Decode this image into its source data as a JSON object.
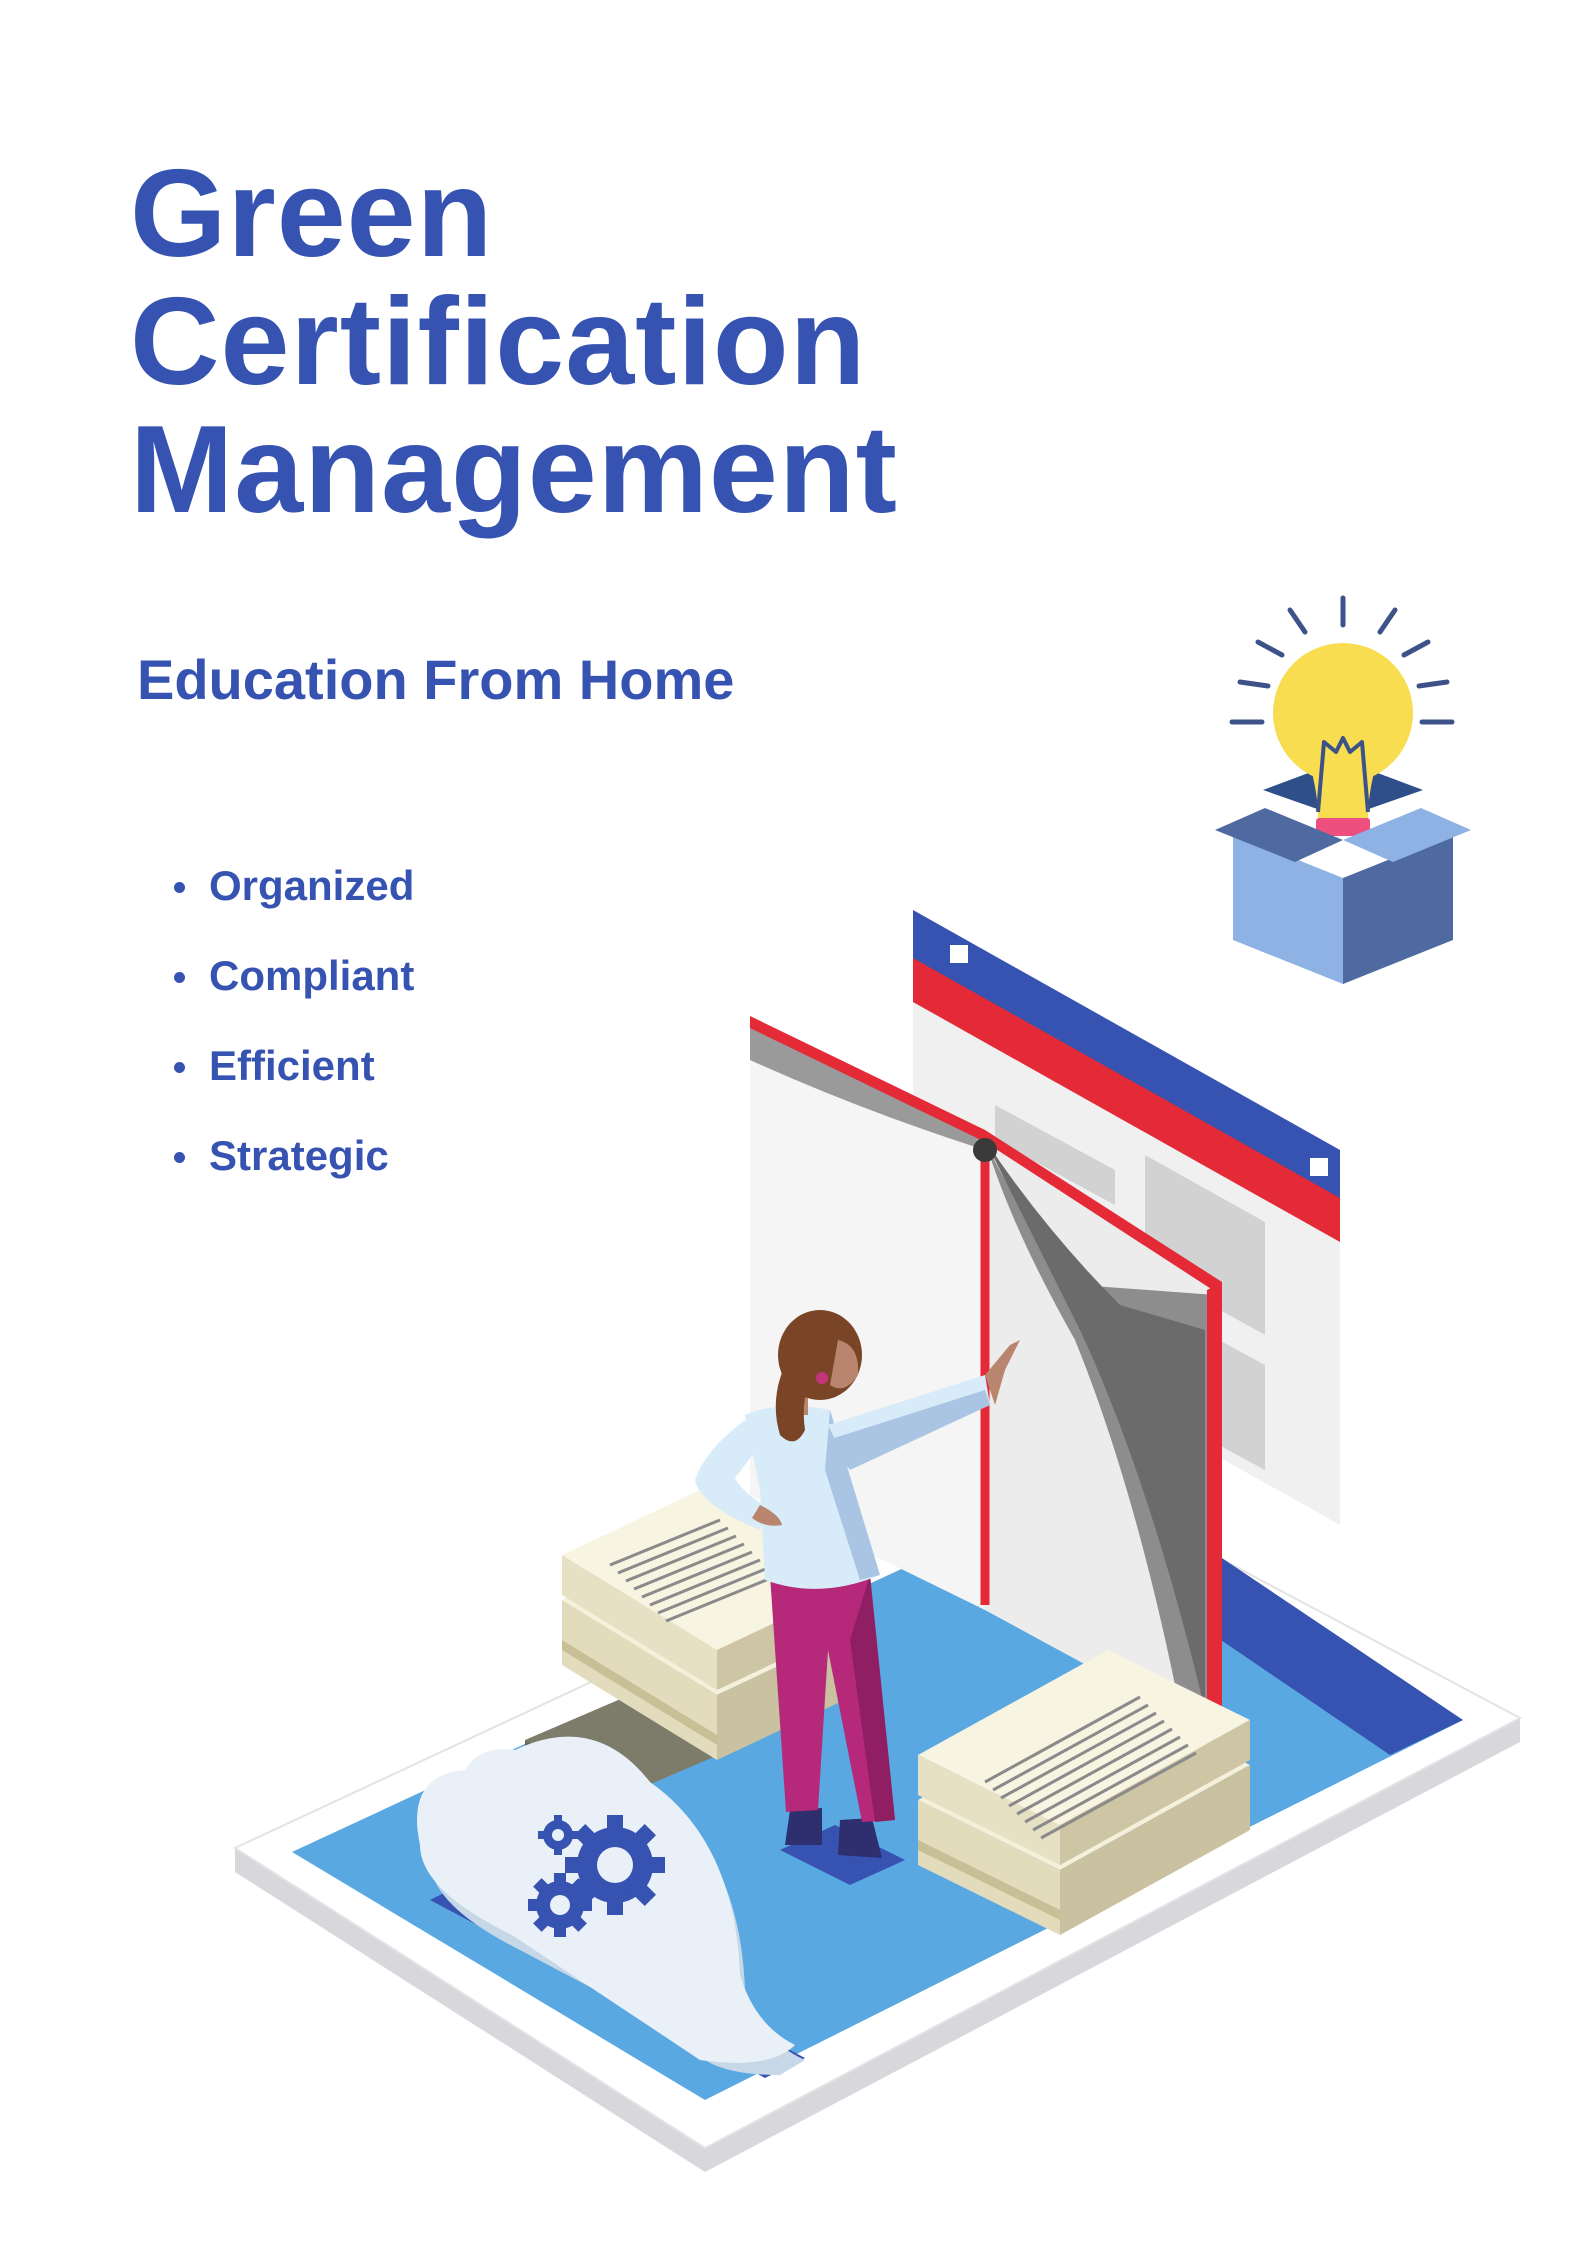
{
  "title_lines": [
    "Green",
    "Certification",
    "Management"
  ],
  "subtitle": "Education From Home",
  "features": [
    "Organized",
    "Compliant",
    "Efficient",
    "Strategic"
  ],
  "colors": {
    "primary_text": "#3653b2",
    "platform_blue": "#5aa8e2",
    "accent_red": "#e32a36",
    "bulb_yellow": "#f7dd4f",
    "skin": "#b9856f",
    "hair": "#7a4526",
    "pants": "#b5287a",
    "shirt": "#d8ebf8"
  },
  "icons": [
    "lightbulb-in-box-icon",
    "cloud-gears-icon",
    "document-stack-icon",
    "open-book-icon",
    "browser-window-icon"
  ]
}
